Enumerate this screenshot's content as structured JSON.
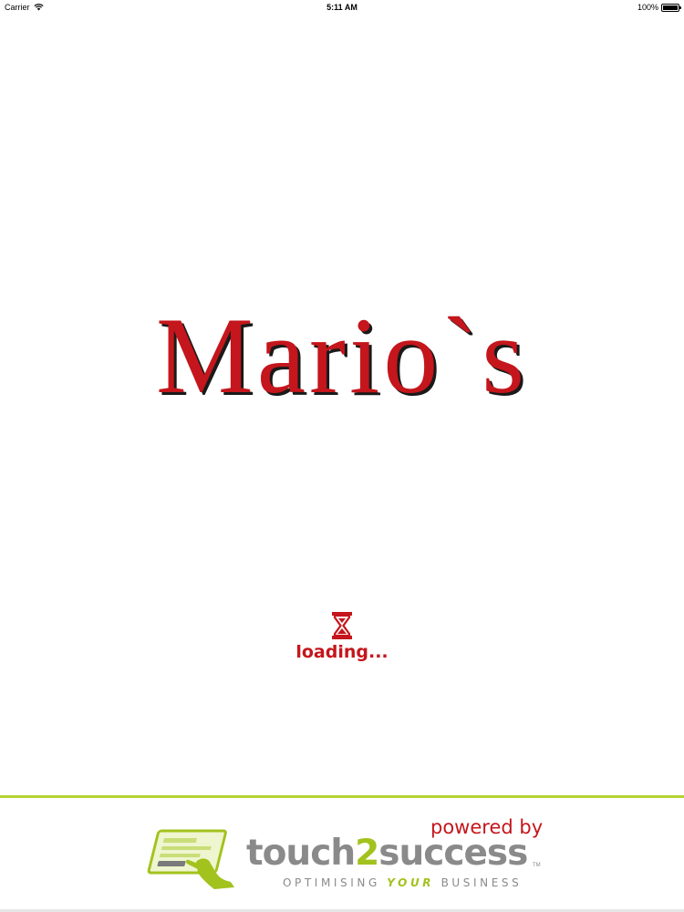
{
  "status_bar": {
    "carrier": "Carrier",
    "time": "5:11 AM",
    "battery_percent": "100%",
    "battery_level": 1.0,
    "wifi_icon": "wifi-icon",
    "battery_icon": "battery-icon"
  },
  "splash": {
    "brand_name": "Mario`s",
    "loading_text": "loading...",
    "loading_icon": "hourglass-icon"
  },
  "footer": {
    "powered_by": "powered by",
    "logo_word_part1": "touch",
    "logo_word_digit": "2",
    "logo_word_part2": "success",
    "trademark": "TM",
    "tagline_part1": "OPTIMISING ",
    "tagline_highlight": "YOUR",
    "tagline_part2": " BUSINESS",
    "logo_icon": "tablet-card-icon"
  },
  "colors": {
    "brand_red": "#c4161c",
    "accent_green": "#a2c21d",
    "divider_green": "#b5d334",
    "logo_gray": "#8a8a8a",
    "background": "#ffffff"
  }
}
